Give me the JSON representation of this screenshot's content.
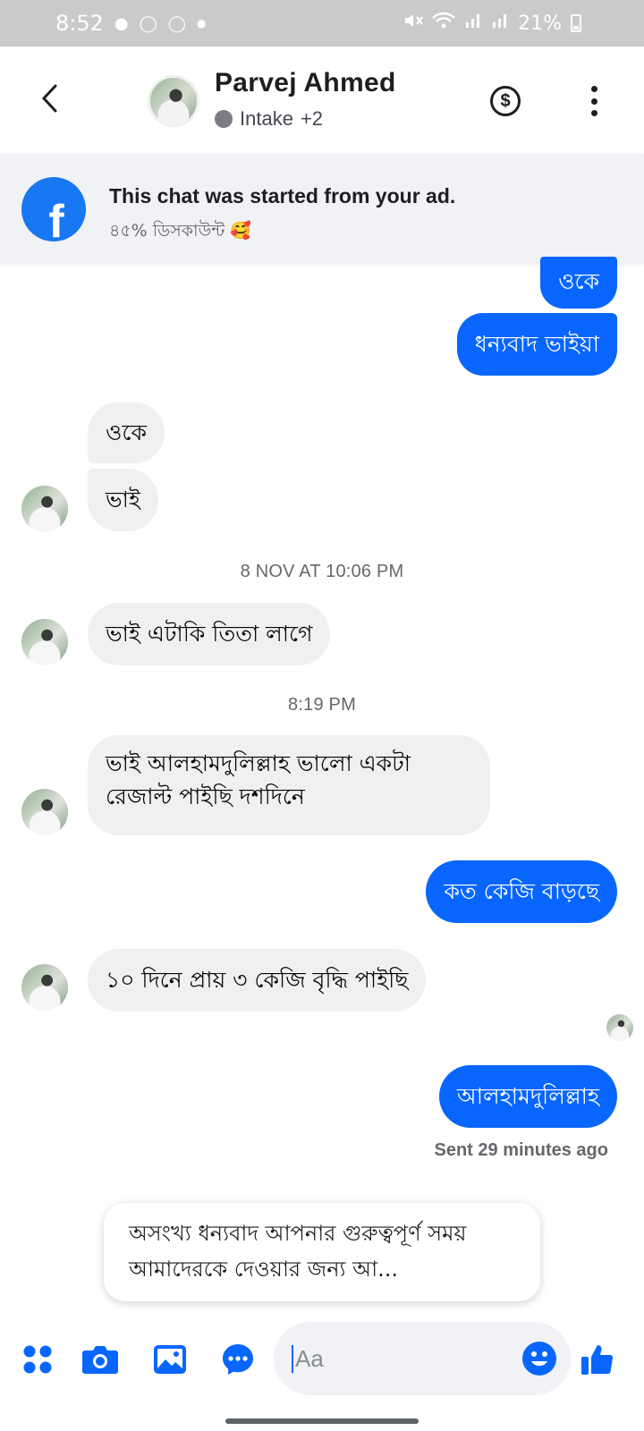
{
  "status_bar": {
    "time": "8:52",
    "battery": "21%",
    "left_icons": [
      "snapchat-icon",
      "app-icon",
      "app-icon",
      "dot-icon"
    ],
    "right_icons": [
      "mute-vibrate-icon",
      "wifi-icon",
      "signal-icon",
      "signal-icon",
      "battery-icon"
    ]
  },
  "header": {
    "name": "Parvej Ahmed",
    "label_tag": "Intake",
    "label_extra": "+2",
    "dollar_symbol": "$"
  },
  "ad_banner": {
    "title": "This chat was started from your ad.",
    "subtitle": "৪৫% ডিসকাউন্ট 🥰"
  },
  "messages": [
    {
      "direction": "out",
      "text": "ওকে"
    },
    {
      "direction": "out",
      "text": "ধন্যবাদ ভাইয়া"
    },
    {
      "direction": "in",
      "text": "ওকে"
    },
    {
      "direction": "in",
      "text": "ভাই"
    },
    {
      "direction": "in",
      "text": "ভাই এটাকি তিতা লাগে"
    },
    {
      "direction": "in",
      "text": "ভাই আলহামদুলিল্লাহ ভালো একটা রেজাল্ট পাইছি দশদিনে"
    },
    {
      "direction": "out",
      "text": "কত কেজি বাড়ছে"
    },
    {
      "direction": "in",
      "text": "১০ দিনে প্রায় ৩ কেজি বৃদ্ধি পাইছি"
    },
    {
      "direction": "out",
      "text": "আলহামদুলিল্লাহ"
    }
  ],
  "timestamps": [
    "8 NOV AT 10:06 PM",
    "8:19 PM"
  ],
  "sent_status": "Sent 29 minutes ago",
  "suggestion": "অসংখ্য ধন্যবাদ আপনার গুরুত্বপূর্ণ সময় আমাদেরকে দেওয়ার জন্য আ...",
  "composer": {
    "placeholder": "Aa"
  },
  "colors": {
    "accent": "#0866ff",
    "incoming_bubble": "#f0f0f0",
    "status_bar": "#c9cacc",
    "banner": "#f0f2f5"
  }
}
